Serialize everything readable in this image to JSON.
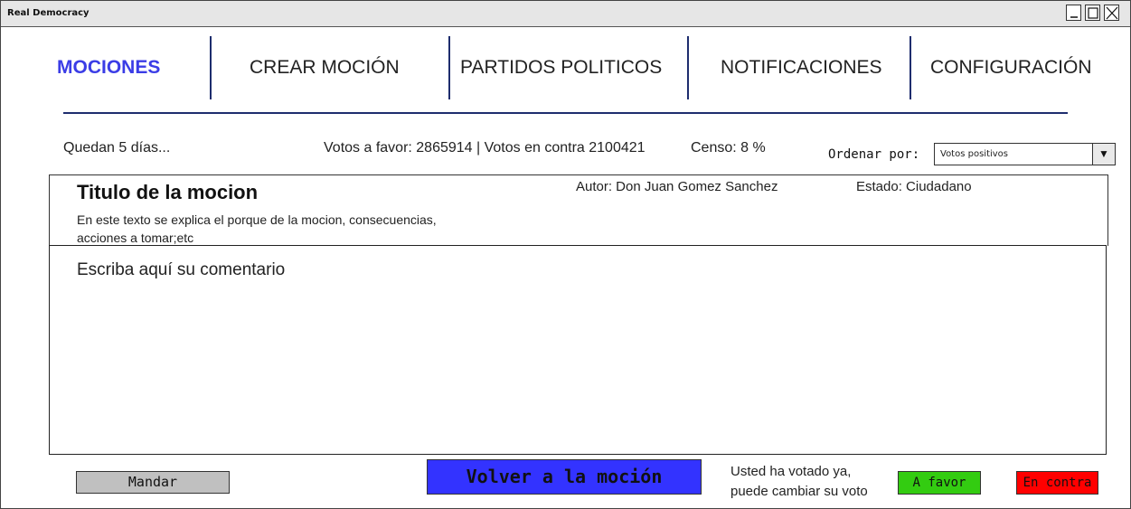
{
  "window": {
    "title": "Real Democracy"
  },
  "nav": {
    "items": [
      {
        "label": "MOCIONES",
        "active": true
      },
      {
        "label": "CREAR MOCIÓN",
        "active": false
      },
      {
        "label": "PARTIDOS POLITICOS",
        "active": false
      },
      {
        "label": "NOTIFICACIONES",
        "active": false
      },
      {
        "label": "CONFIGURACIÓN",
        "active": false
      }
    ],
    "active_color": "#3b3de6"
  },
  "info": {
    "time_left": "Quedan 5 días...",
    "votes": "Votos a favor: 2865914 | Votos en contra 2100421",
    "census": "Censo: 8 %"
  },
  "sort": {
    "label": "Ordenar por:",
    "selected": "Votos positivos"
  },
  "motion": {
    "title": "Titulo de la mocion",
    "description": "En este texto se explica el porque de la mocion, consecuencias, acciones a tomar;etc",
    "author": "Autor: Don Juan Gomez Sanchez",
    "state": "Estado: Ciudadano"
  },
  "comment": {
    "placeholder": "Escriba aquí su comentario"
  },
  "actions": {
    "send_label": "Mandar",
    "back_label": "Volver a la moción",
    "vote_note_line1": "Usted ha votado ya,",
    "vote_note_line2": "puede cambiar su voto",
    "favor_label": "A favor",
    "contra_label": "En contra"
  },
  "colors": {
    "back_button": "#3333ff",
    "favor_button": "#33cc11",
    "contra_button": "#ff0000",
    "send_button": "#c0c0c0"
  }
}
